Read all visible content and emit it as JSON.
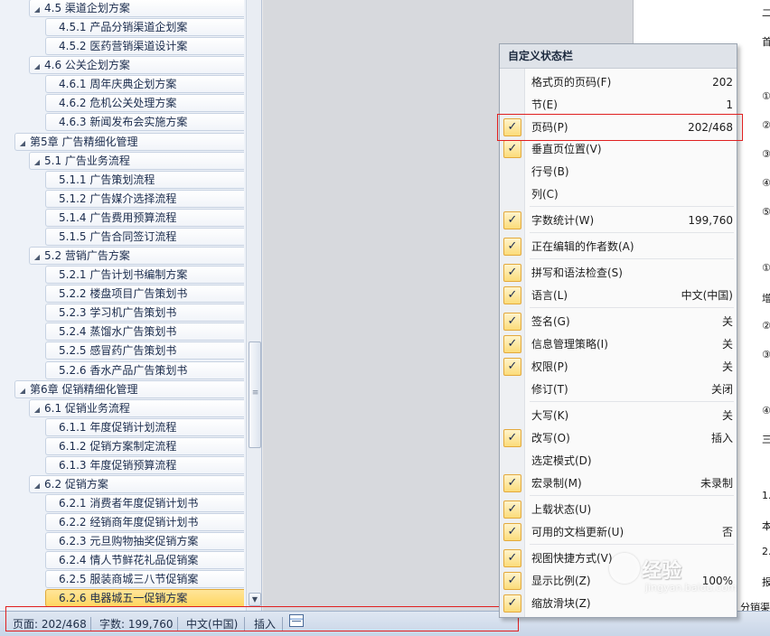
{
  "navigation": {
    "items": [
      {
        "label": "4.5  渠道企划方案",
        "level": 1,
        "expanded": true
      },
      {
        "label": "4.5.1  产品分销渠道企划案",
        "level": 2
      },
      {
        "label": "4.5.2 医药营销渠道设计案",
        "level": 2
      },
      {
        "label": "4.6  公关企划方案",
        "level": 1,
        "expanded": true
      },
      {
        "label": "4.6.1  周年庆典企划方案",
        "level": 2
      },
      {
        "label": "4.6.2 危机公关处理方案",
        "level": 2
      },
      {
        "label": "4.6.3 新闻发布会实施方案",
        "level": 2
      },
      {
        "label": "第5章  广告精细化管理",
        "level": 0,
        "expanded": true
      },
      {
        "label": "5.1  广告业务流程",
        "level": 1,
        "expanded": true
      },
      {
        "label": "5.1.1  广告策划流程",
        "level": 2
      },
      {
        "label": "5.1.2  广告媒介选择流程",
        "level": 2
      },
      {
        "label": "5.1.4  广告费用预算流程",
        "level": 2
      },
      {
        "label": "5.1.5  广告合同签订流程",
        "level": 2
      },
      {
        "label": "5.2  营销广告方案",
        "level": 1,
        "expanded": true
      },
      {
        "label": "5.2.1  广告计划书编制方案",
        "level": 2
      },
      {
        "label": "5.2.2 楼盘项目广告策划书",
        "level": 2
      },
      {
        "label": "5.2.3 学习机广告策划书",
        "level": 2
      },
      {
        "label": "5.2.4 蒸馏水广告策划书",
        "level": 2
      },
      {
        "label": "5.2.5 感冒药广告策划书",
        "level": 2
      },
      {
        "label": "5.2.6  香水产品广告策划书",
        "level": 2
      },
      {
        "label": "第6章  促销精细化管理",
        "level": 0,
        "expanded": true
      },
      {
        "label": "6.1  促销业务流程",
        "level": 1,
        "expanded": true
      },
      {
        "label": "6.1.1  年度促销计划流程",
        "level": 2
      },
      {
        "label": "6.1.2  促销方案制定流程",
        "level": 2
      },
      {
        "label": "6.1.3  年度促销预算流程",
        "level": 2
      },
      {
        "label": "6.2  促销方案",
        "level": 1,
        "expanded": true
      },
      {
        "label": "6.2.1  消费者年度促销计划书",
        "level": 2
      },
      {
        "label": "6.2.2 经销商年度促销计划书",
        "level": 2
      },
      {
        "label": "6.2.3 元旦购物抽奖促销方案",
        "level": 2
      },
      {
        "label": "6.2.4 情人节鲜花礼品促销案",
        "level": 2
      },
      {
        "label": "6.2.5  服装商城三八节促销案",
        "level": 2
      },
      {
        "label": "6.2.6  电器城五一促销方案",
        "level": 2,
        "selected": true
      }
    ]
  },
  "status_bar": {
    "page": "页面: 202/468",
    "word_count": "字数: 199,760",
    "language": "中文(中国)",
    "insert_mode": "插入"
  },
  "context_menu": {
    "title": "自定义状态栏",
    "items": [
      {
        "label": "格式页的页码(F)",
        "value": "202",
        "checked": false
      },
      {
        "label": "节(E)",
        "value": "1",
        "checked": false
      },
      {
        "label": "页码(P)",
        "value": "202/468",
        "checked": true
      },
      {
        "label": "垂直页位置(V)",
        "value": "",
        "checked": true
      },
      {
        "label": "行号(B)",
        "value": "",
        "checked": false
      },
      {
        "label": "列(C)",
        "value": "",
        "checked": false
      },
      {
        "label": "字数统计(W)",
        "value": "199,760",
        "checked": true
      },
      {
        "label": "正在编辑的作者数(A)",
        "value": "",
        "checked": true
      },
      {
        "label": "拼写和语法检查(S)",
        "value": "",
        "checked": true
      },
      {
        "label": "语言(L)",
        "value": "中文(中国)",
        "checked": true
      },
      {
        "label": "签名(G)",
        "value": "关",
        "checked": true
      },
      {
        "label": "信息管理策略(I)",
        "value": "关",
        "checked": true
      },
      {
        "label": "权限(P)",
        "value": "关",
        "checked": true
      },
      {
        "label": "修订(T)",
        "value": "关闭",
        "checked": false
      },
      {
        "label": "大写(K)",
        "value": "关",
        "checked": false
      },
      {
        "label": "改写(O)",
        "value": "插入",
        "checked": true
      },
      {
        "label": "选定模式(D)",
        "value": "",
        "checked": false
      },
      {
        "label": "宏录制(M)",
        "value": "未录制",
        "checked": true
      },
      {
        "label": "上载状态(U)",
        "value": "",
        "checked": true
      },
      {
        "label": "可用的文档更新(U)",
        "value": "否",
        "checked": true
      },
      {
        "label": "视图快捷方式(V)",
        "value": "",
        "checked": true
      },
      {
        "label": "显示比例(Z)",
        "value": "100%",
        "checked": true
      },
      {
        "label": "缩放滑块(Z)",
        "value": "",
        "checked": true
      }
    ]
  },
  "document": {
    "visible_chars": [
      "二",
      "首",
      "（",
      "①",
      "②",
      "③",
      "④",
      "⑤",
      "（",
      "①",
      "增",
      "②",
      "③",
      "④",
      "三",
      "（",
      "1.",
      "本",
      "2.",
      "报",
      "分销渠"
    ]
  },
  "watermark": {
    "text": "经验",
    "subtext": "jingyan.baidu.com"
  },
  "colors": {
    "highlight_box": "#e02020",
    "selected_item": "#ffd660",
    "check_bg": "#fbdc7a"
  }
}
